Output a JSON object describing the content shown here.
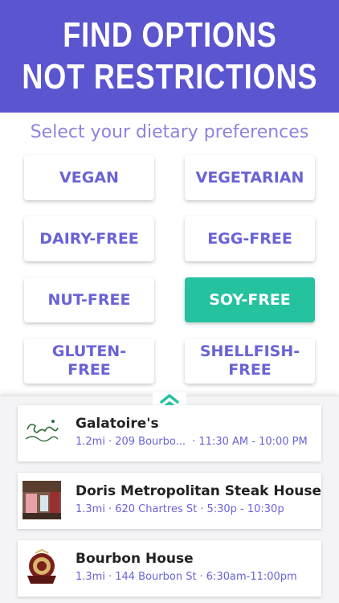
{
  "banner": {
    "line1": "FIND OPTIONS",
    "line2": "NOT RESTRICTIONS",
    "color": "#5b55cf"
  },
  "preferences": {
    "title": "Select your dietary preferences",
    "options": [
      {
        "label": "VEGAN",
        "selected": false
      },
      {
        "label": "VEGETARIAN",
        "selected": false
      },
      {
        "label": "DAIRY-FREE",
        "selected": false
      },
      {
        "label": "EGG-FREE",
        "selected": false
      },
      {
        "label": "NUT-FREE",
        "selected": false
      },
      {
        "label": "SOY-FREE",
        "selected": true
      },
      {
        "label": "GLUTEN-\nFREE",
        "selected": false
      },
      {
        "label": "SHELLFISH-\nFREE",
        "selected": false
      }
    ],
    "accent": "#6a63d6",
    "selected_color": "#25c2a0"
  },
  "sheet": {
    "handle_icon": "chevron-up-double-icon"
  },
  "restaurants": [
    {
      "name": "Galatoire's",
      "distance": "1.2mi",
      "address": "· 209 Bourbo...",
      "hours": "· 11:30 AM - 10:00 PM",
      "thumb": "galatoires-logo"
    },
    {
      "name": "Doris Metropolitan Steak House",
      "distance": "1.3mi",
      "address": "· 620 Chartres St",
      "hours": "· 5:30p - 10:30p",
      "thumb": "doris-photo"
    },
    {
      "name": "Bourbon House",
      "distance": "1.3mi",
      "address": "· 144 Bourbon St",
      "hours": "· 6:30am-11:00pm",
      "thumb": "bourbon-house-logo"
    }
  ]
}
